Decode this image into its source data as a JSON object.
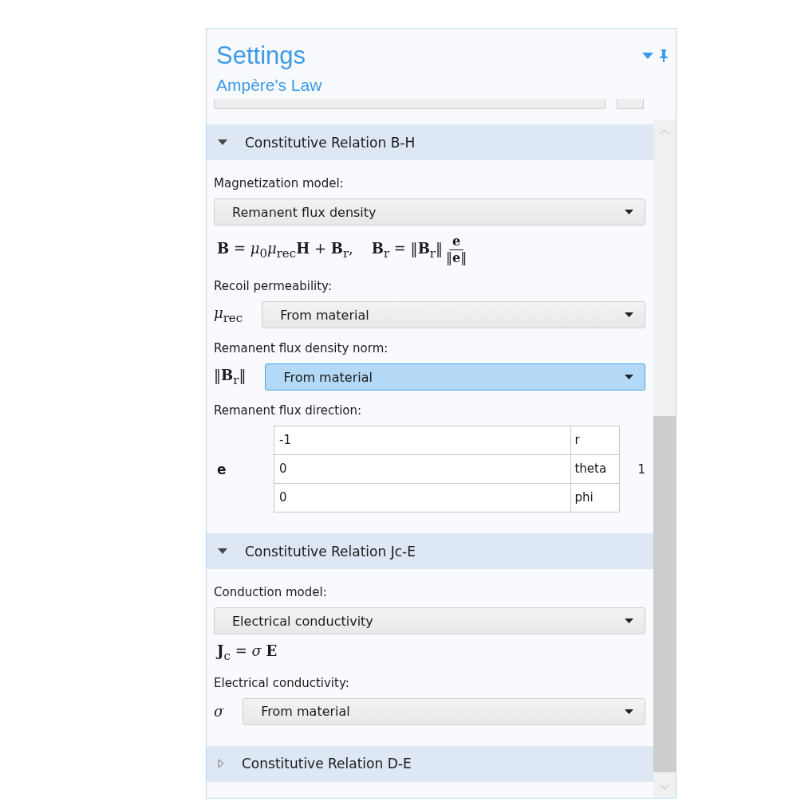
{
  "panel": {
    "title": "Settings",
    "subtitle": "Ampère's Law"
  },
  "sections": [
    {
      "title": "Constitutive Relation B-H",
      "expanded": true,
      "items": [
        {
          "kind": "label",
          "text": "Magnetization model:"
        },
        {
          "kind": "select",
          "value": "Remanent flux density",
          "focused": false
        },
        {
          "kind": "formula",
          "text": "**B** = *μ*$_{0}$*μ*$_{rec}$**H** + **B**$_{r}$,    **B**$_{r}$ = ‖**B**$_{r}$‖",
          "numerator": "**e**",
          "denominator": "‖**e**‖"
        },
        {
          "kind": "label",
          "text": "Recoil permeability:"
        },
        {
          "kind": "select",
          "symbol": "*μ*$_{rec}$",
          "value": "From material",
          "focused": false
        },
        {
          "kind": "label",
          "text": "Remanent flux density norm:"
        },
        {
          "kind": "select",
          "symbol": "‖**B**$_{r}$‖",
          "value": "From material",
          "focused": true
        },
        {
          "kind": "label",
          "text": "Remanent flux direction:"
        },
        {
          "kind": "vector",
          "symbol": "**e**",
          "count": "1",
          "rows": [
            {
              "value": "-1",
              "unit": "r"
            },
            {
              "value": "0",
              "unit": "theta"
            },
            {
              "value": "0",
              "unit": "phi"
            }
          ]
        }
      ]
    },
    {
      "title": "Constitutive Relation Jc-E",
      "expanded": true,
      "items": [
        {
          "kind": "label",
          "text": "Conduction model:"
        },
        {
          "kind": "select",
          "value": "Electrical conductivity",
          "focused": false
        },
        {
          "kind": "formula",
          "text": "**J**$_{c}$ = *σ* **E**"
        },
        {
          "kind": "label",
          "text": "Electrical conductivity:"
        },
        {
          "kind": "select",
          "symbol": "*σ*",
          "value": "From material",
          "focused": false
        }
      ]
    },
    {
      "title": "Constitutive Relation D-E",
      "expanded": false
    }
  ]
}
